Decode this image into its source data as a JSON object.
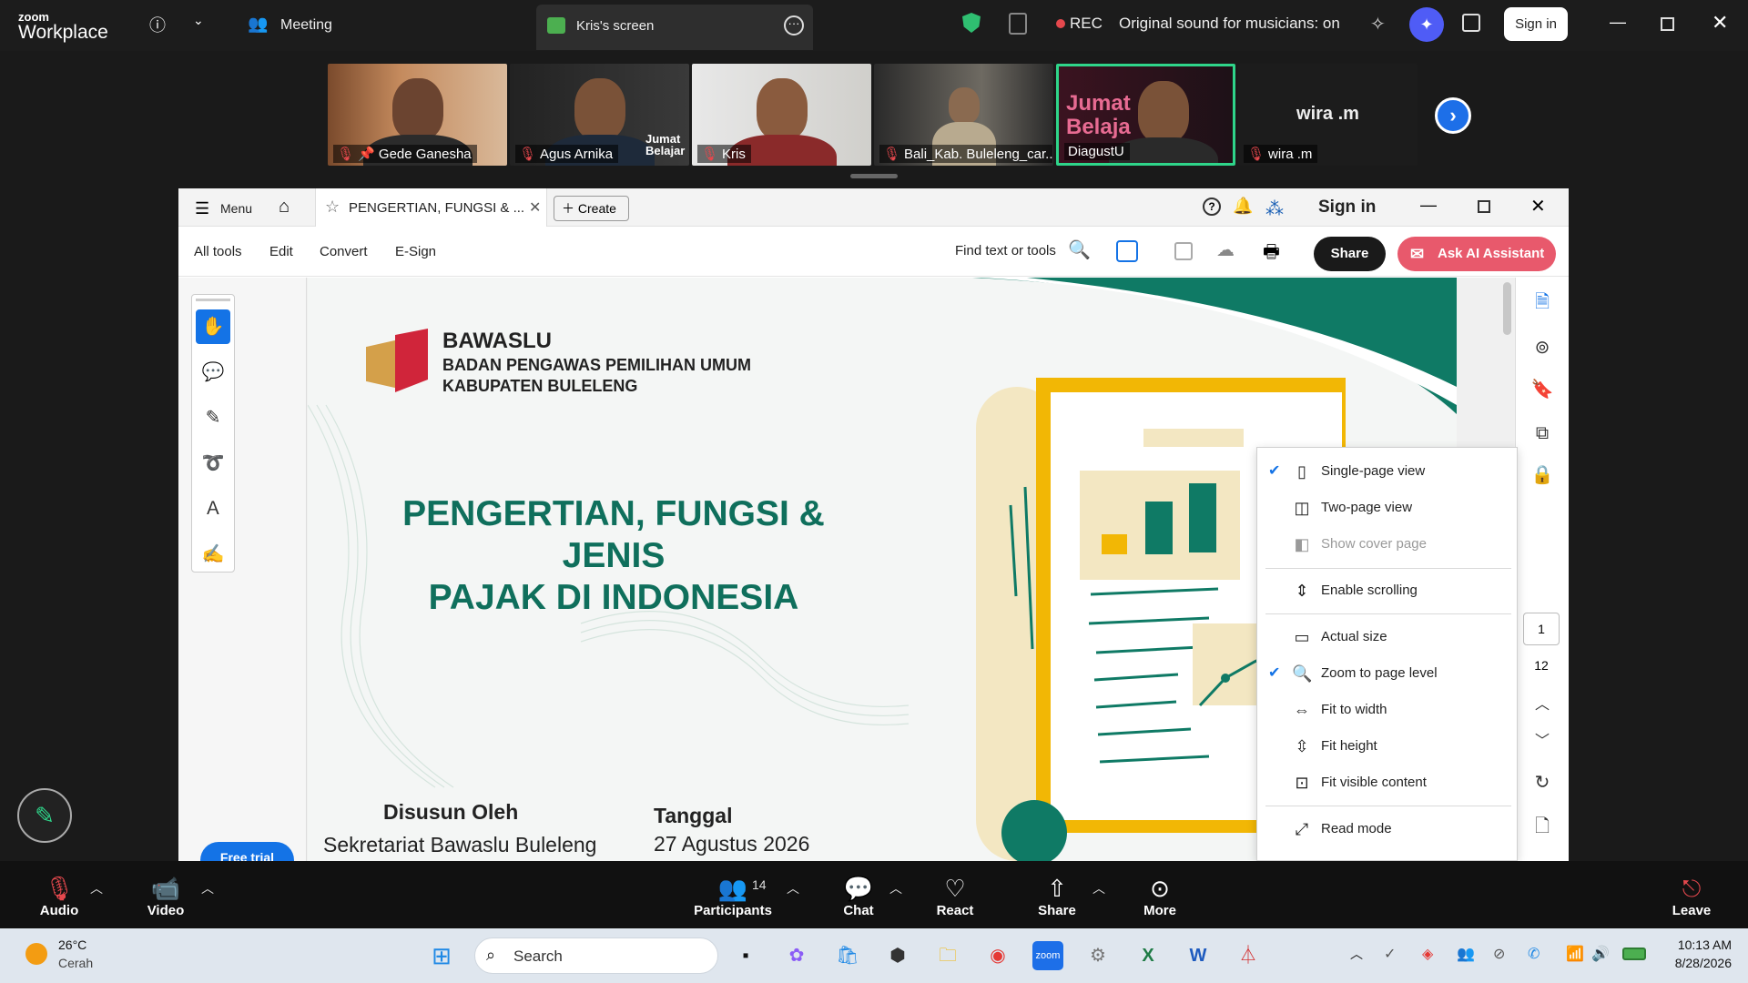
{
  "zoom_top": {
    "logo_line1": "zoom",
    "logo_line2": "Workplace",
    "meeting_label": "Meeting",
    "screen_tab_label": "Kris's screen",
    "rec_label": "REC",
    "sound_status": "Original sound for musicians: on",
    "sign_in_label": "Sign in"
  },
  "participants": [
    {
      "name": "Gede Ganesha",
      "muted": true,
      "pinned": true
    },
    {
      "name": "Agus Arnika",
      "muted": true,
      "overlay": "Jumat Belajar"
    },
    {
      "name": "Kris",
      "muted": true
    },
    {
      "name": "Bali_Kab. Buleleng_car...",
      "muted": true
    },
    {
      "name": "DiagustU",
      "muted": false,
      "active_speaker": true,
      "overlay": "Jumat Belaja"
    },
    {
      "name": "wira .m",
      "muted": true,
      "no_video": true,
      "display_name": "wira .m"
    }
  ],
  "acrobat": {
    "header": {
      "menu_label": "Menu",
      "tab_title": "PENGERTIAN, FUNGSI & ...",
      "create_label": "Create",
      "sign_in_label": "Sign in"
    },
    "toolbar": {
      "items": [
        "All tools",
        "Edit",
        "Convert",
        "E-Sign"
      ],
      "find_label": "Find text or tools",
      "share_label": "Share",
      "ask_ai_label": "Ask AI Assistant"
    },
    "free_trial_label": "Free trial",
    "page_current": "1",
    "page_total": "12"
  },
  "slide": {
    "org_name": "BAWASLU",
    "org_line2": "BADAN PENGAWAS PEMILIHAN UMUM",
    "org_line3": "KABUPATEN BULELENG",
    "title_line1": "PENGERTIAN, FUNGSI & JENIS",
    "title_line2": "PAJAK DI INDONESIA",
    "author_label": "Disusun Oleh",
    "author_value": "Sekretariat Bawaslu Buleleng",
    "date_label": "Tanggal",
    "date_value": "27 Agustus 2026",
    "colors": {
      "title": "#0f6f5c",
      "accent_yellow": "#f2b705",
      "teal": "#0f7a65"
    }
  },
  "view_menu": {
    "items": [
      {
        "label": "Single-page view",
        "checked": true,
        "disabled": false,
        "icon": "single-page-icon"
      },
      {
        "label": "Two-page view",
        "checked": false,
        "disabled": false,
        "icon": "two-page-icon"
      },
      {
        "label": "Show cover page",
        "checked": false,
        "disabled": true,
        "icon": "cover-page-icon"
      },
      {
        "label": "Enable scrolling",
        "checked": false,
        "disabled": false,
        "icon": "scroll-icon"
      },
      {
        "label": "Actual size",
        "checked": false,
        "disabled": false,
        "icon": "actual-size-icon"
      },
      {
        "label": "Zoom to page level",
        "checked": true,
        "disabled": false,
        "icon": "zoom-page-icon"
      },
      {
        "label": "Fit to width",
        "checked": false,
        "disabled": false,
        "icon": "fit-width-icon"
      },
      {
        "label": "Fit height",
        "checked": false,
        "disabled": false,
        "icon": "fit-height-icon"
      },
      {
        "label": "Fit visible content",
        "checked": false,
        "disabled": false,
        "icon": "fit-content-icon"
      },
      {
        "label": "Read mode",
        "checked": false,
        "disabled": false,
        "icon": "read-mode-icon"
      }
    ]
  },
  "zoom_bottom": {
    "audio": "Audio",
    "video": "Video",
    "participants": "Participants",
    "participants_count": "14",
    "chat": "Chat",
    "react": "React",
    "share": "Share",
    "more": "More",
    "leave": "Leave"
  },
  "taskbar": {
    "weather_temp": "26°C",
    "weather_desc": "Cerah",
    "search_label": "Search",
    "time": "10:13 AM",
    "date": "8/28/2026"
  }
}
